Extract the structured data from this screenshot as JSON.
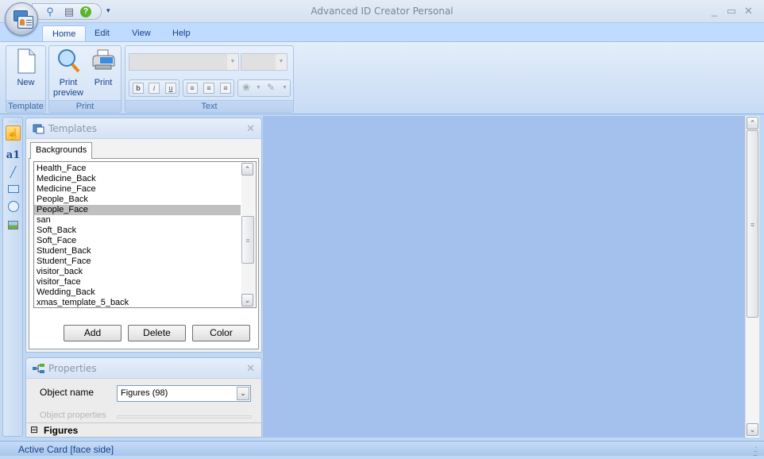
{
  "window": {
    "title": "Advanced ID Creator Personal",
    "controls": {
      "minimize": "_",
      "maximize": "▭",
      "close": "✕"
    }
  },
  "quick_access": {
    "items": [
      {
        "icon": "print-preview-icon",
        "glyph": "🔍"
      },
      {
        "icon": "print-icon",
        "glyph": "🖨"
      },
      {
        "icon": "help-icon",
        "glyph": "?"
      }
    ],
    "customize_glyph": "▾"
  },
  "menu_tabs": [
    {
      "label": "Home",
      "active": true
    },
    {
      "label": "Edit",
      "active": false
    },
    {
      "label": "View",
      "active": false
    },
    {
      "label": "Help",
      "active": false
    }
  ],
  "ribbon": {
    "groups": [
      {
        "label": "Template",
        "buttons": [
          {
            "label": "New"
          }
        ]
      },
      {
        "label": "Print",
        "buttons": [
          {
            "label": "Print preview"
          },
          {
            "label": "Print"
          }
        ]
      },
      {
        "label": "Text",
        "font_family": "",
        "font_size": "",
        "format_buttons": [
          "b",
          "i",
          "u"
        ],
        "align_buttons": [
          "align-left",
          "align-center",
          "align-right"
        ]
      }
    ]
  },
  "toolbox": {
    "tools": [
      "select",
      "text",
      "line",
      "rectangle",
      "ellipse",
      "image"
    ],
    "active": "select"
  },
  "templates_panel": {
    "title": "Templates",
    "close": "✕",
    "tab": "Backgrounds",
    "items": [
      "Health_Face",
      "Medicine_Back",
      "Medicine_Face",
      "People_Back",
      "People_Face",
      "san",
      "Soft_Back",
      "Soft_Face",
      "Student_Back",
      "Student_Face",
      "visitor_back",
      "visitor_face",
      "Wedding_Back",
      "xmas_template_5_back"
    ],
    "selected": "People_Face",
    "buttons": {
      "add": "Add",
      "delete": "Delete",
      "color": "Color"
    }
  },
  "properties_panel": {
    "title": "Properties",
    "close": "✕",
    "object_name_label": "Object name",
    "object_name_value": "Figures (98)",
    "object_properties_label": "Object properties",
    "category": "Figures",
    "category_toggle": "⊟"
  },
  "status": {
    "text": "Active Card [face side]"
  },
  "colors": {
    "canvas": "#a4c1ee",
    "ribbon_text": "#15428b",
    "selection": "#c0c0c0"
  }
}
